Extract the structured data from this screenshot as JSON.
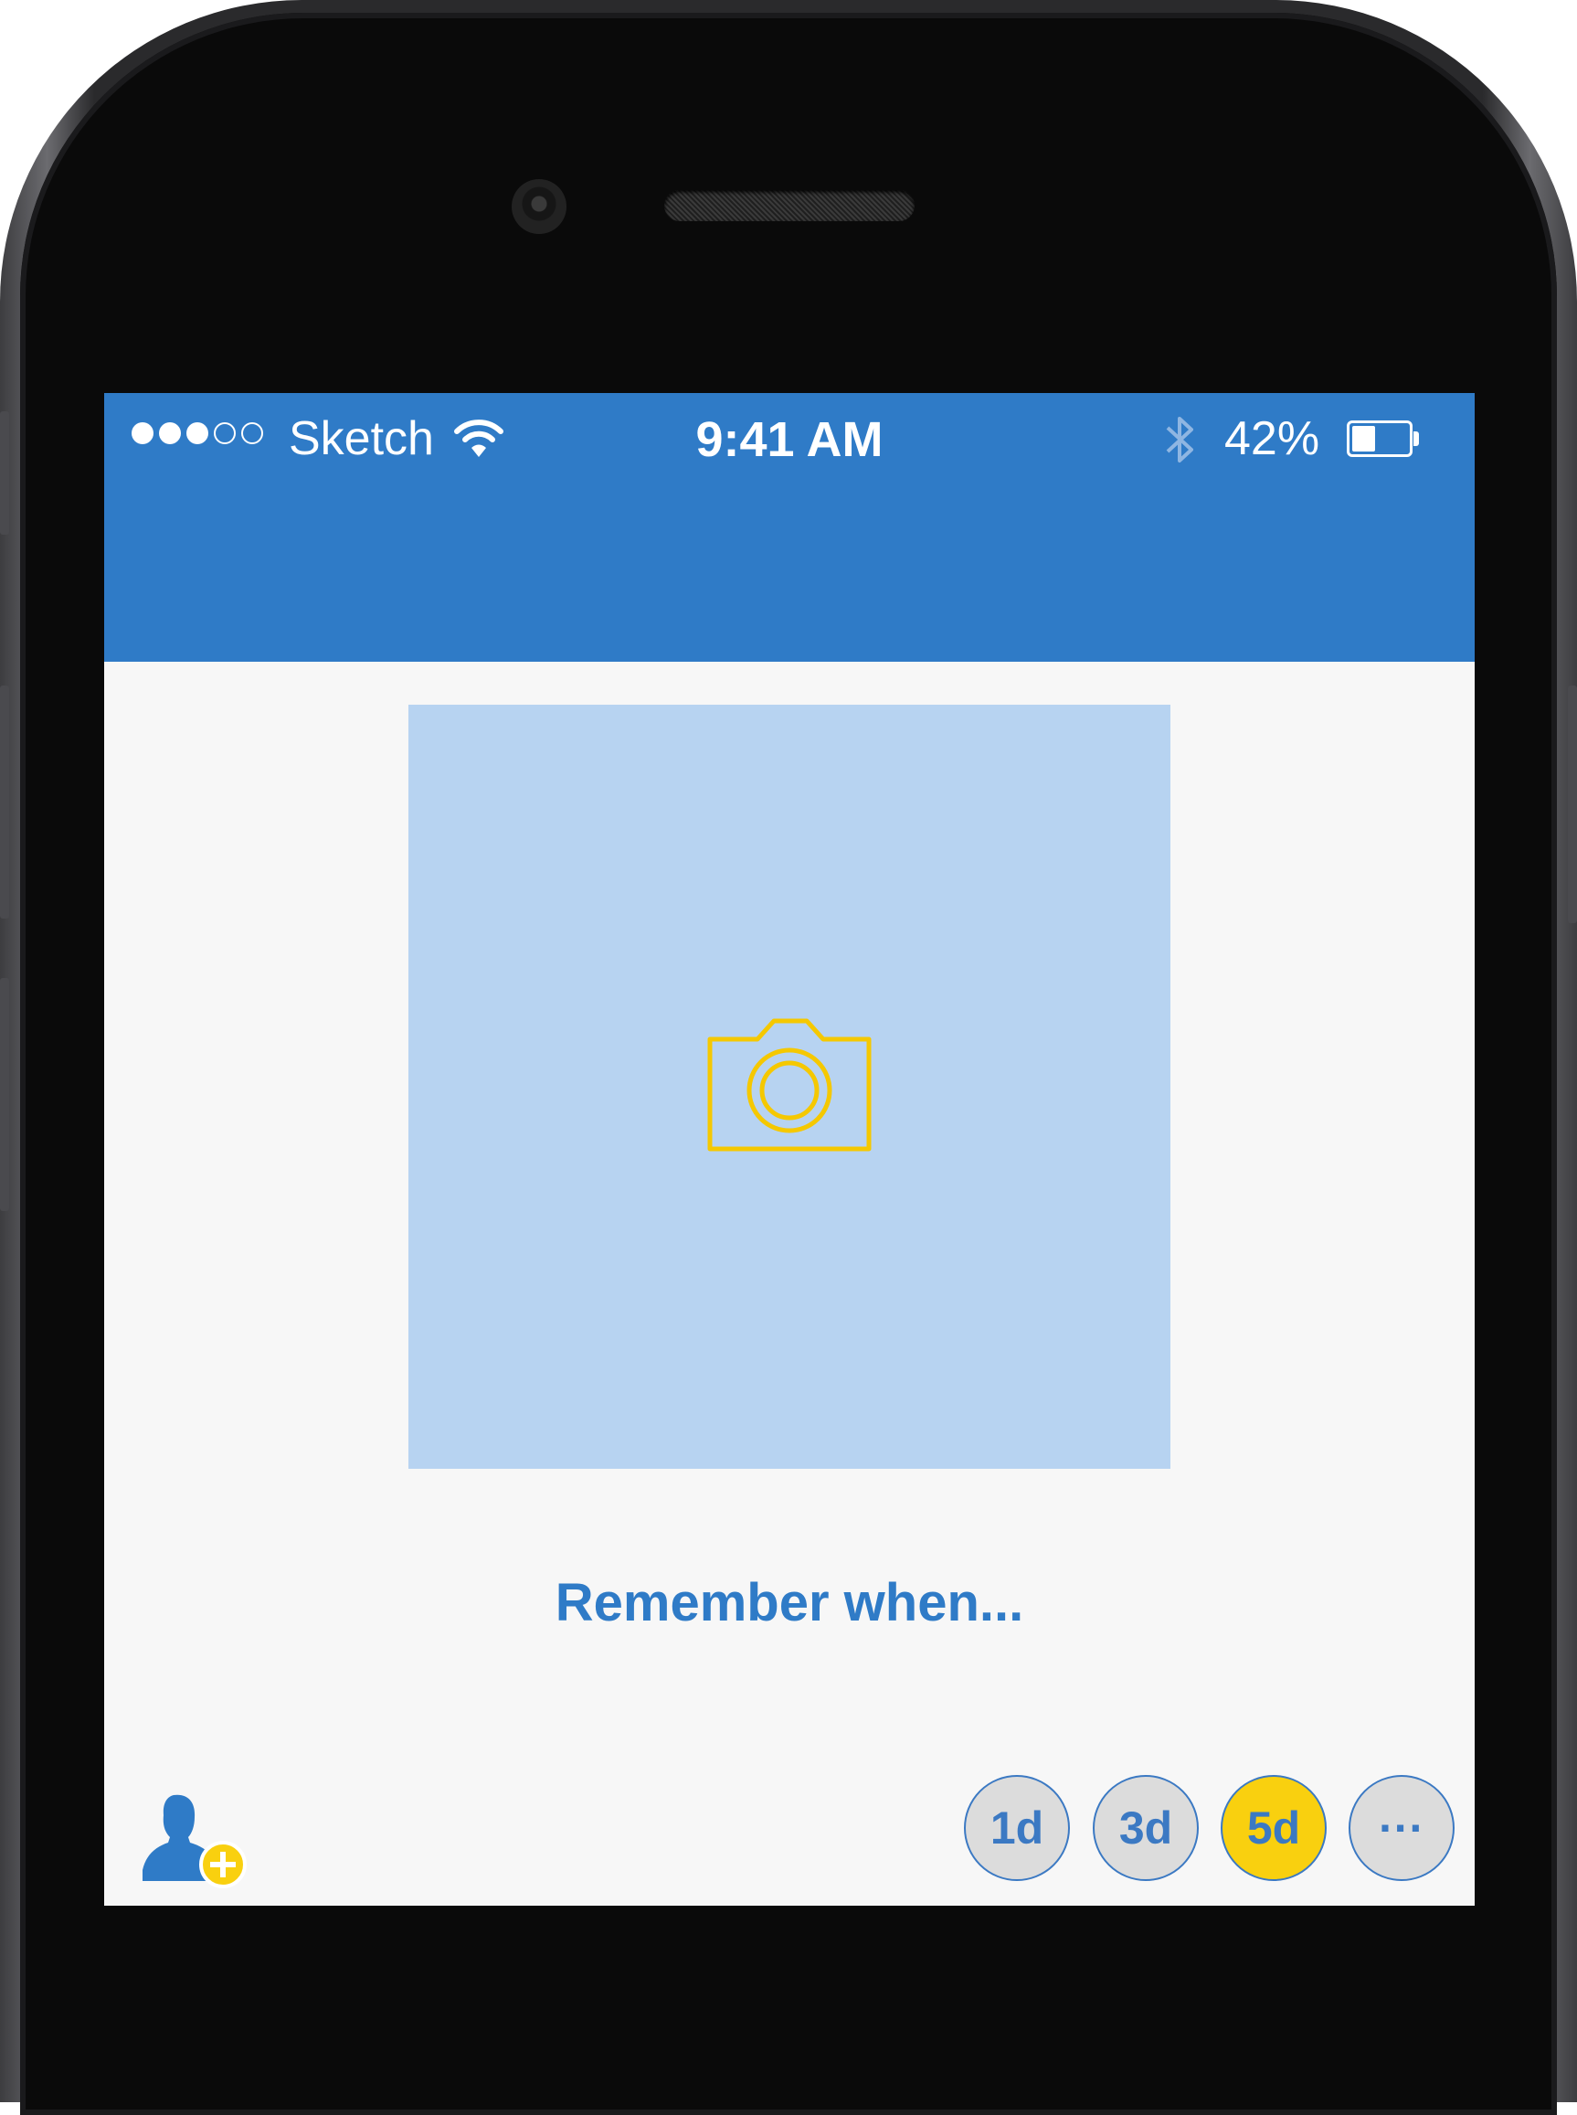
{
  "status_bar": {
    "carrier": "Sketch",
    "time": "9:41 AM",
    "battery_percent_label": "42%",
    "battery_level": 0.42,
    "signal_strength": 3
  },
  "main": {
    "caption": "Remember when..."
  },
  "footer": {
    "duration_options": [
      {
        "label": "1d",
        "selected": false
      },
      {
        "label": "3d",
        "selected": false
      },
      {
        "label": "5d",
        "selected": true
      },
      {
        "label": "···",
        "selected": false
      }
    ]
  },
  "colors": {
    "nav_blue": "#2f7bc7",
    "photo_placeholder": "#b7d3f1",
    "accent_yellow": "#f9d00f"
  },
  "icons": [
    "wifi-icon",
    "bluetooth-icon",
    "battery-icon",
    "camera-icon",
    "add-user-icon"
  ]
}
